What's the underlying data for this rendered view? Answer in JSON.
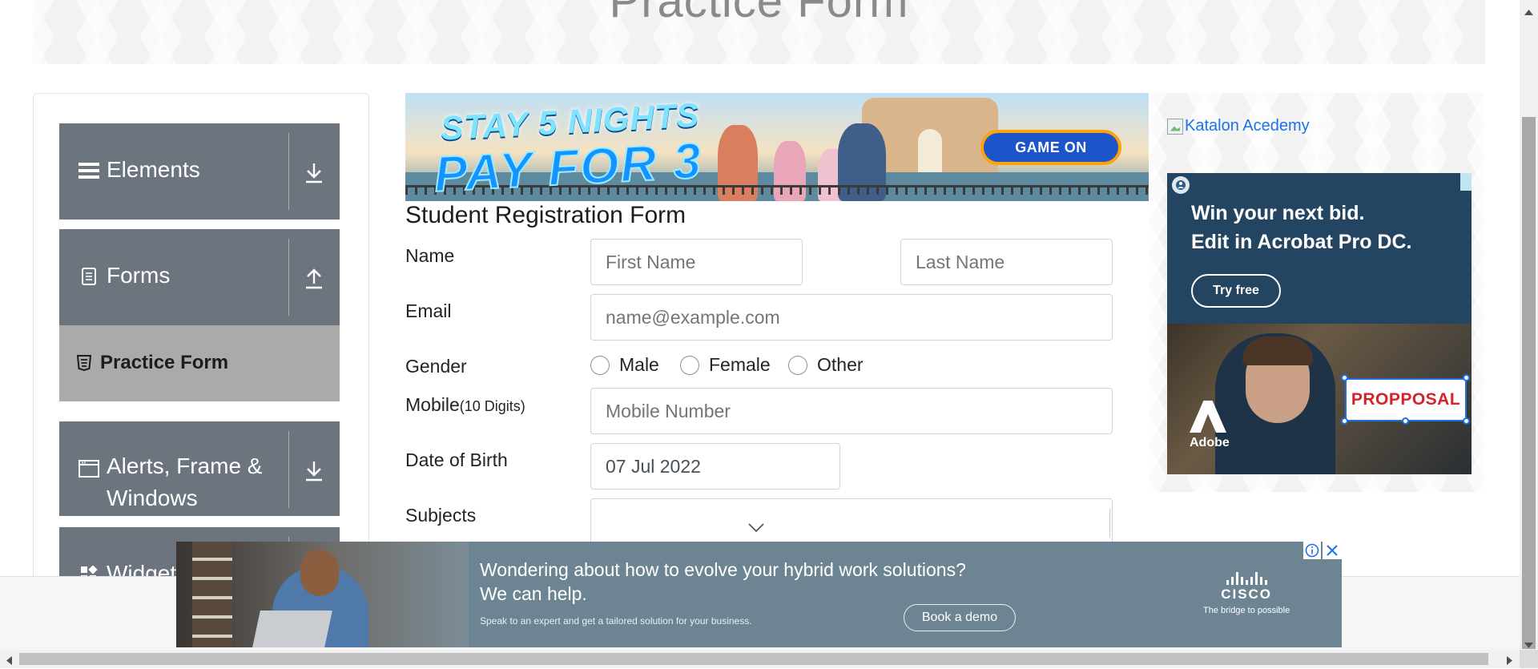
{
  "header": {
    "title": "Practice Form"
  },
  "sidebar": {
    "groups": [
      {
        "label": "Elements",
        "icon": "hamburger-icon",
        "toggle": "download-arrow-icon"
      },
      {
        "label": "Forms",
        "icon": "document-icon",
        "toggle": "upload-arrow-icon"
      },
      {
        "label": "Alerts, Frame & Windows",
        "icon": "window-icon",
        "toggle": "download-arrow-icon"
      },
      {
        "label": "Widgets",
        "icon": "widgets-icon",
        "toggle": "download-arrow-icon"
      }
    ],
    "active_item": {
      "label": "Practice Form",
      "icon": "html5-icon"
    }
  },
  "top_ad": {
    "headline_1": "STAY 5 NIGHTS",
    "headline_2": "PAY FOR 3",
    "cta": "GAME ON"
  },
  "form": {
    "title": "Student Registration Form",
    "name_label": "Name",
    "first_name_placeholder": "First Name",
    "last_name_placeholder": "Last Name",
    "email_label": "Email",
    "email_placeholder": "name@example.com",
    "gender_label": "Gender",
    "gender_options": [
      "Male",
      "Female",
      "Other"
    ],
    "mobile_label": "Mobile",
    "mobile_hint": "(10 Digits)",
    "mobile_placeholder": "Mobile Number",
    "dob_label": "Date of Birth",
    "dob_value": "07 Jul 2022",
    "subjects_label": "Subjects"
  },
  "right_ads": {
    "katalon_alt": "Katalon Acedemy",
    "adobe": {
      "headline": "Win your next bid.\nEdit in Acrobat Pro DC.",
      "cta": "Try free",
      "logo_word": "Adobe",
      "proposal_text": "PROPPOSAL"
    }
  },
  "bottom_ad": {
    "line1": "Wondering about how to evolve your hybrid work solutions?",
    "line2": "We can help.",
    "line3": "Speak to an expert and get a tailored solution for your business.",
    "cta": "Book a demo",
    "brand": "CISCO",
    "tagline": "The bridge to possible"
  },
  "colors": {
    "sidebar_group_bg": "#6c757d",
    "sidebar_active_bg": "#aaaaaa",
    "link_blue": "#1a73e8"
  }
}
